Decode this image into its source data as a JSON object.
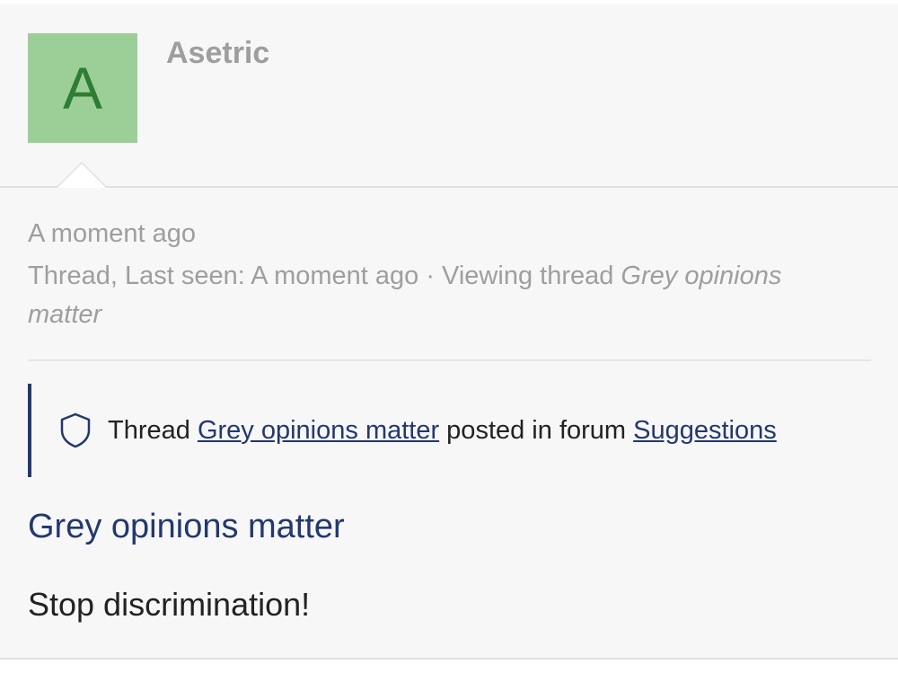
{
  "user": {
    "avatar_letter": "A",
    "avatar_color": "#9ccf97",
    "name": "Asetric"
  },
  "activity": {
    "timestamp": "A moment ago",
    "status_prefix": "Thread, Last seen: A moment ago · Viewing thread ",
    "status_thread": "Grey opinions matter"
  },
  "notice": {
    "icon": "shield-icon",
    "prefix": "Thread ",
    "thread_link": "Grey opinions matter",
    "middle": " posted in forum ",
    "forum_link": "Suggestions"
  },
  "post": {
    "title": "Grey opinions matter",
    "body": "Stop discrimination!"
  },
  "colors": {
    "accent": "#23386e",
    "muted": "#9e9e9e",
    "avatar_text": "#2e7d32"
  }
}
